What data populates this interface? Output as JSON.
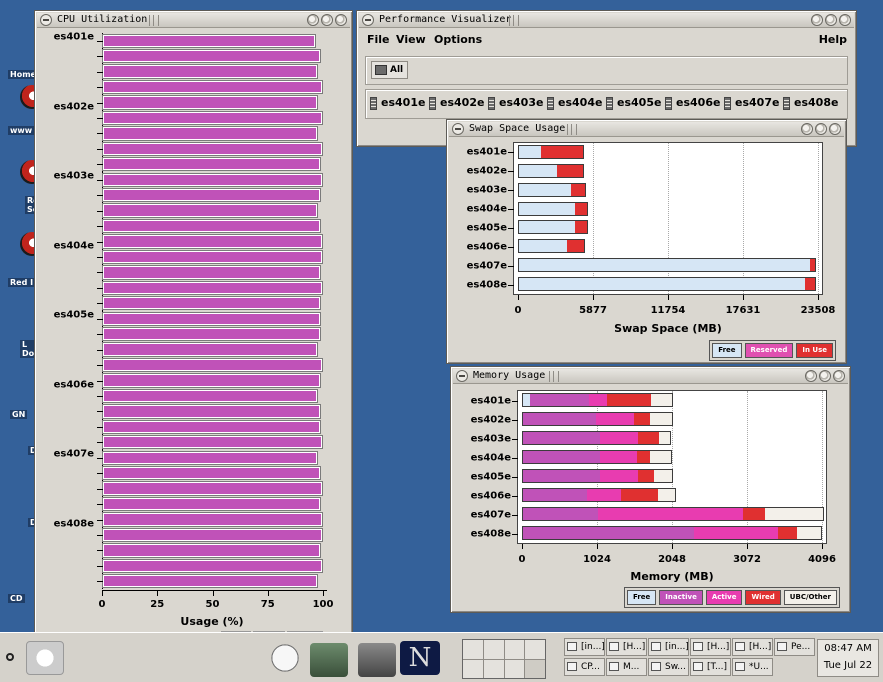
{
  "desktop": {
    "icons": [
      "Home",
      "www",
      "Re\nSe",
      "Red I",
      "L\nDoc",
      "GN",
      "D",
      "D",
      "CD"
    ]
  },
  "cpu_window": {
    "title": "CPU Utilization",
    "chart_data": {
      "type": "bar",
      "orientation": "horizontal",
      "title": "",
      "xlabel": "Usage (%)",
      "xticks": [
        "0",
        "25",
        "50",
        "75",
        "100"
      ],
      "xlim": [
        0,
        100
      ],
      "hosts": [
        "es401e",
        "es402e",
        "es403e",
        "es404e",
        "es405e",
        "es406e",
        "es407e",
        "es408e"
      ],
      "values": [
        96,
        98,
        97,
        99,
        97,
        99,
        97,
        99,
        98,
        99,
        98,
        97,
        98,
        99,
        99,
        98,
        99,
        98,
        98,
        98,
        97,
        99,
        98,
        97,
        98,
        98,
        99,
        97,
        98,
        99,
        98,
        99,
        99,
        98,
        99,
        97
      ]
    }
  },
  "perf_window": {
    "title": "Performance Visualizer",
    "menu": {
      "file": "File",
      "view": "View",
      "options": "Options",
      "help": "Help"
    },
    "all_button": "All",
    "hosts": [
      "es401e",
      "es402e",
      "es403e",
      "es404e",
      "es405e",
      "es406e",
      "es407e",
      "es408e"
    ]
  },
  "swap_window": {
    "title": "Swap Space Usage",
    "chart_data": {
      "type": "bar",
      "orientation": "horizontal",
      "stacked": true,
      "xlabel": "Swap Space (MB)",
      "xticks": [
        "0",
        "5877",
        "11754",
        "17631",
        "23508"
      ],
      "xlim": [
        0,
        23508
      ],
      "categories": [
        "es401e",
        "es402e",
        "es403e",
        "es404e",
        "es405e",
        "es406e",
        "es407e",
        "es408e"
      ],
      "series": [
        {
          "name": "Free",
          "color": "#d6e6f5",
          "values": [
            1700,
            3000,
            4100,
            4400,
            4400,
            3800,
            22800,
            22400
          ]
        },
        {
          "name": "Reserved",
          "color": "#e050b0",
          "values": [
            0,
            0,
            0,
            0,
            0,
            0,
            0,
            0
          ]
        },
        {
          "name": "In Use",
          "color": "#e03030",
          "values": [
            3300,
            2000,
            1100,
            900,
            900,
            1300,
            400,
            800
          ]
        }
      ],
      "legend": [
        "Free",
        "Reserved",
        "In Use"
      ]
    }
  },
  "memory_window": {
    "title": "Memory Usage",
    "chart_data": {
      "type": "bar",
      "orientation": "horizontal",
      "stacked": true,
      "xlabel": "Memory (MB)",
      "xticks": [
        "0",
        "1024",
        "2048",
        "3072",
        "4096"
      ],
      "xlim": [
        0,
        4096
      ],
      "categories": [
        "es401e",
        "es402e",
        "es403e",
        "es404e",
        "es405e",
        "es406e",
        "es407e",
        "es408e"
      ],
      "series": [
        {
          "name": "Free",
          "color": "#d6e6f5",
          "values": [
            100,
            0,
            0,
            0,
            0,
            0,
            0,
            0
          ]
        },
        {
          "name": "Inactive",
          "color": "#c052b8",
          "values": [
            800,
            1000,
            1050,
            1050,
            1050,
            880,
            1020,
            2330
          ]
        },
        {
          "name": "Active",
          "color": "#e83cb0",
          "values": [
            250,
            520,
            520,
            510,
            520,
            460,
            1980,
            1150
          ]
        },
        {
          "name": "Wired",
          "color": "#e03030",
          "values": [
            600,
            220,
            290,
            180,
            220,
            500,
            300,
            260
          ]
        },
        {
          "name": "UBC/Other",
          "color": "#f3f0ea",
          "values": [
            280,
            300,
            150,
            280,
            250,
            230,
            790,
            330
          ]
        }
      ],
      "legend": [
        "Free",
        "Inactive",
        "Active",
        "Wired",
        "UBC/Other"
      ]
    }
  },
  "taskbar": {
    "tasks": [
      "[in...]",
      "[H...]",
      "[in...]",
      "[H...]",
      "[H...]",
      "Pe...",
      "CP...",
      "M...",
      "Sw...",
      "[T...]",
      "*U..."
    ],
    "clock_time": "08:47 AM",
    "clock_date": "Tue Jul 22"
  },
  "colors": {
    "desktop": "#34619a",
    "cpu_bar": "#c052b8",
    "window_bg": "#dad7d0"
  }
}
